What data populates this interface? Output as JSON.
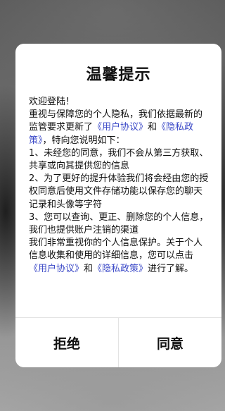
{
  "dialog": {
    "title": "温馨提示",
    "welcome": "欢迎登陆！",
    "intro_prefix": "重视与保障您的个人隐私，我们依据最新的监管要求更新了",
    "user_agreement_link": "《用户协议》",
    "and": "和",
    "privacy_policy_link": "《隐私政策》",
    "intro_suffix": "，特向您说明如下：",
    "item_1": "1、未经您的同意，我们不会从第三方获取、共享或向其提供您的信息",
    "item_2": "2、为了更好的提升体验我们将会经由您的授权同意后使用文件存储功能以保存您的聊天记录和头像等字符",
    "item_3": "3、您可以查询、更正、删除您的个人信息，我们也提供账户注销的渠道",
    "closing_prefix": "我们非常重视你的个人信息保护。关于个人信息收集和使用的详细信息，您可以点击",
    "closing_suffix": "进行了解。",
    "reject_label": "拒绝",
    "agree_label": "同意"
  }
}
